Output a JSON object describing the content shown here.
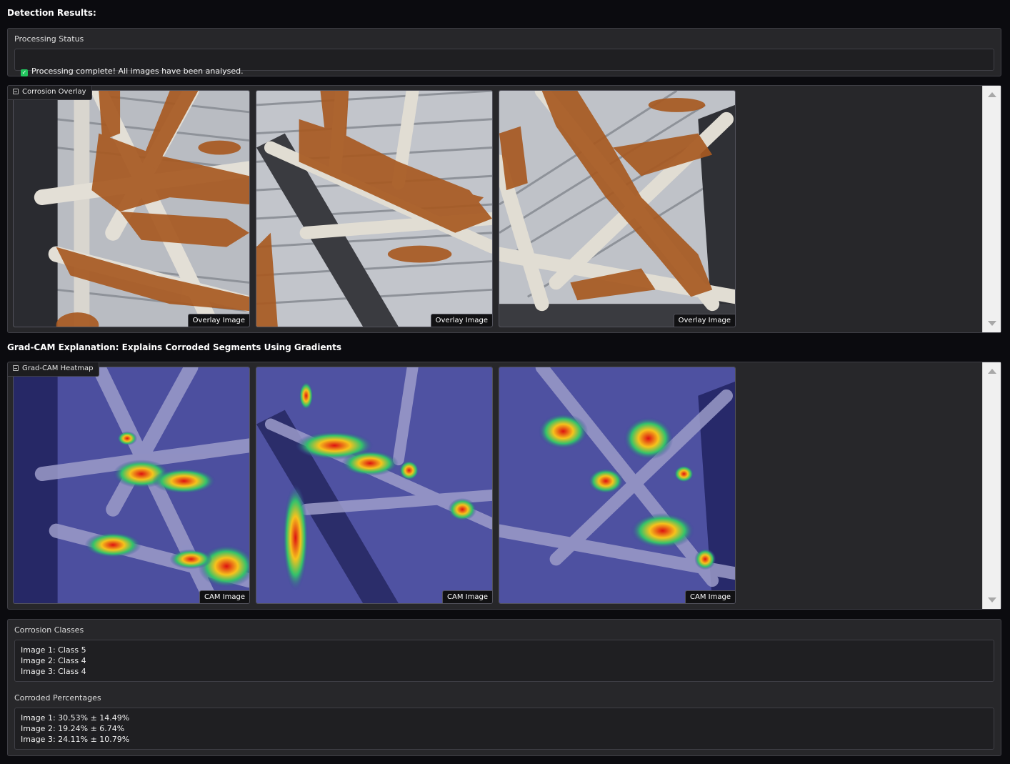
{
  "page": {
    "title": "Detection Results:"
  },
  "status": {
    "label": "Processing Status",
    "message": "Processing complete! All images have been analysed.",
    "icon": "check-icon"
  },
  "overlay_gallery": {
    "label": "Corrosion Overlay",
    "images": [
      {
        "caption": "Overlay Image"
      },
      {
        "caption": "Overlay Image"
      },
      {
        "caption": "Overlay Image"
      }
    ]
  },
  "gradcam": {
    "title": "Grad-CAM Explanation: Explains Corroded Segments Using Gradients",
    "label": "Grad-CAM Heatmap",
    "images": [
      {
        "caption": "CAM Image"
      },
      {
        "caption": "CAM Image"
      },
      {
        "caption": "CAM Image"
      }
    ]
  },
  "classes": {
    "label": "Corrosion Classes",
    "text": "Image 1: Class 5\nImage 2: Class 4\nImage 3: Class 4"
  },
  "percentages": {
    "label": "Corroded Percentages",
    "text": "Image 1: 30.53% ± 14.49%\nImage 2: 19.24% ± 6.74%\nImage 3: 24.11% ± 10.79%"
  },
  "colors": {
    "background": "#0b0b0f",
    "panel": "#27272a",
    "corrosion_overlay": "#a85a22",
    "heatmap_base": "#3b3f9e"
  }
}
